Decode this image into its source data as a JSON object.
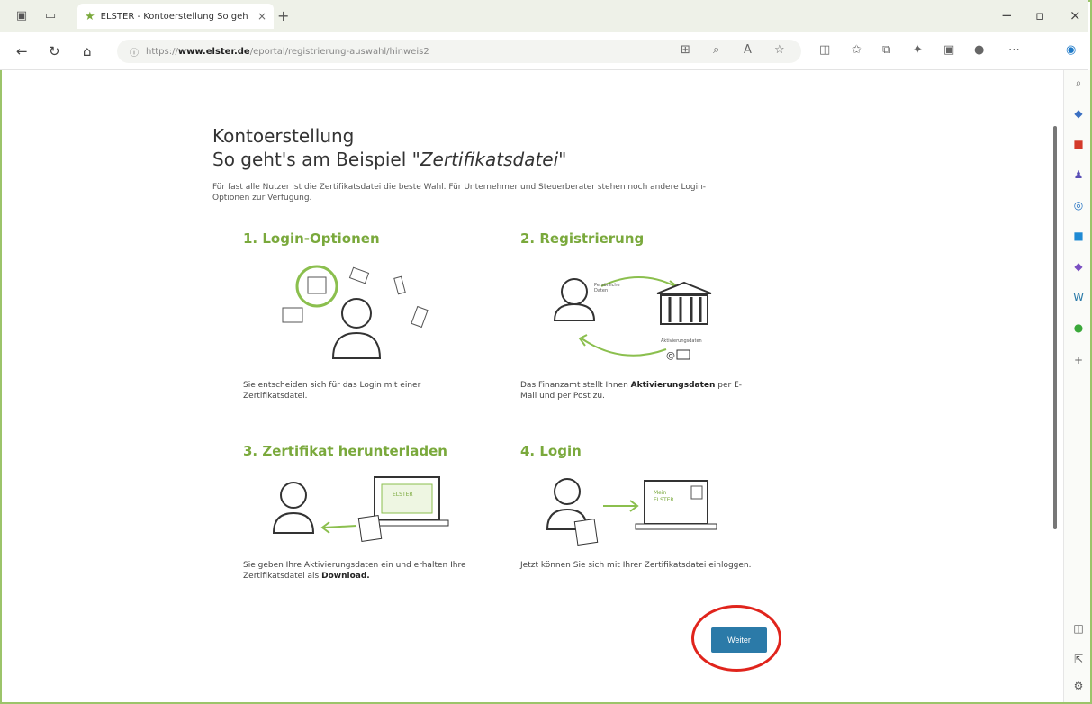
{
  "browser": {
    "tab_title": "ELSTER - Kontoerstellung So geh",
    "tab_close": "×",
    "new_tab": "+",
    "url_prefix": "https://",
    "url_host": "www.elster.de",
    "url_path": "/eportal/registrierung-auswahl/hinweis2",
    "window_controls": [
      "−",
      "▫",
      "×"
    ],
    "nav": {
      "back": "←",
      "refresh": "↻",
      "home": "⌂"
    }
  },
  "page": {
    "heading_line1": "Kontoerstellung",
    "heading_line2_plain": "So geht's am Beispiel ",
    "heading_line2_emph": "\"Zertifikatsdatei\"",
    "intro": "Für fast alle Nutzer ist die Zertifikatsdatei die beste Wahl. Für Unternehmer und Steuerberater stehen noch andere Login-Optionen zur Verfügung.",
    "steps": [
      {
        "title": "1. Login-Optionen",
        "text": "Sie entscheiden sich für das Login mit einer Zertifikatsdatei."
      },
      {
        "title": "2. Registrierung",
        "text_before": "Das Finanzamt stellt Ihnen ",
        "text_bold": "Aktivierungsdaten",
        "text_after": " per E-Mail und per Post zu.",
        "label_personal": "Persönliche Daten",
        "label_activation": "Aktivierungsdaten"
      },
      {
        "title": "3. Zertifikat herunterladen",
        "text_before": "Sie geben Ihre Aktivierungsdaten ein und erhalten Ihre Zertifikatsdatei als ",
        "text_bold": "Download.",
        "label_screen": "ELSTER"
      },
      {
        "title": "4. Login",
        "text": "Jetzt können Sie sich mit Ihrer Zertifikatsdatei einloggen.",
        "label_screen_l1": "Mein",
        "label_screen_l2": "ELSTER"
      }
    ],
    "weiter_button": "Weiter"
  },
  "colors": {
    "accent_green": "#7aa93c",
    "button_blue": "#2b7aa8",
    "highlight_red": "#e0241c"
  }
}
